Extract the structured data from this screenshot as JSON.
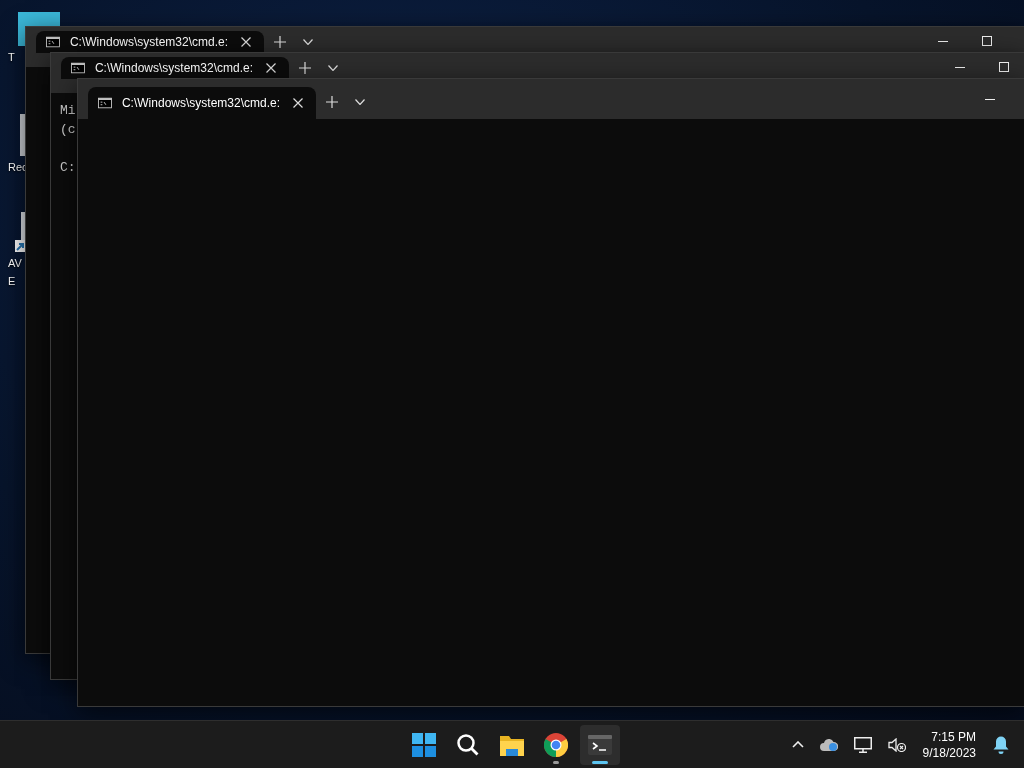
{
  "desktop_icons": [
    {
      "kind": "app",
      "lines": [
        "T"
      ]
    },
    {
      "kind": "recycle",
      "lines": [
        "Rec"
      ]
    },
    {
      "kind": "shortcut",
      "lines": [
        "AV",
        "E"
      ]
    }
  ],
  "windows": [
    {
      "tab_title": "C:\\Windows\\system32\\cmd.e:",
      "maximize_visible": true
    },
    {
      "tab_title": "C:\\Windows\\system32\\cmd.e:",
      "maximize_visible": true,
      "console_blocks": [
        [
          "Mi",
          "(c"
        ],
        [
          "C:"
        ]
      ]
    },
    {
      "tab_title": "C:\\Windows\\system32\\cmd.e:",
      "maximize_visible": false
    }
  ],
  "taskbar": {
    "apps": [
      {
        "kind": "start",
        "running": false,
        "focused": false
      },
      {
        "kind": "search",
        "running": false,
        "focused": false
      },
      {
        "kind": "explorer",
        "running": false,
        "focused": false
      },
      {
        "kind": "chrome",
        "running": true,
        "focused": false
      },
      {
        "kind": "terminal",
        "running": true,
        "focused": true
      }
    ],
    "clock": {
      "time": "7:15 PM",
      "date": "9/18/2023"
    }
  }
}
